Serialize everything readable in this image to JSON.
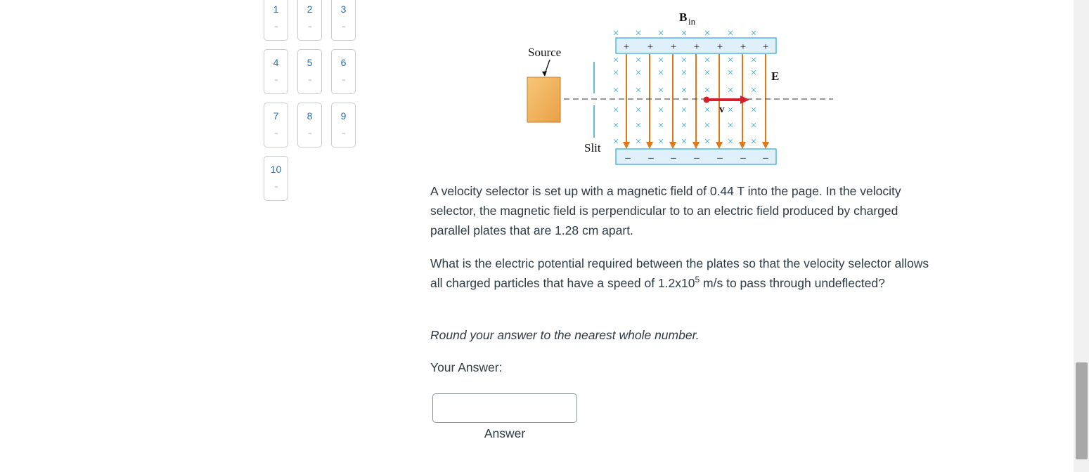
{
  "nav": {
    "items": [
      {
        "num": "1",
        "status": "--"
      },
      {
        "num": "2",
        "status": "--"
      },
      {
        "num": "3",
        "status": "--"
      },
      {
        "num": "4",
        "status": "--"
      },
      {
        "num": "5",
        "status": "--"
      },
      {
        "num": "6",
        "status": "--"
      },
      {
        "num": "7",
        "status": "--"
      },
      {
        "num": "8",
        "status": "--"
      },
      {
        "num": "9",
        "status": "--"
      },
      {
        "num": "10",
        "status": "--"
      }
    ]
  },
  "figure": {
    "b_label": "B",
    "b_sub": "in",
    "source_label": "Source",
    "slit_label": "Slit",
    "e_label": "E",
    "v_label": "v",
    "plus": "+",
    "minus": "–",
    "cross": "×"
  },
  "question": {
    "para1": "A velocity selector is set up with a magnetic field of 0.44 T into the page. In the velocity selector, the magnetic field is perpendicular to to an electric field produced by charged parallel plates that are 1.28 cm apart.",
    "para2_a": "What is the electric potential required between the plates so that the velocity selector allows all charged particles that have a speed of 1.2x10",
    "para2_sup": "5",
    "para2_b": " m/s to pass through undeflected?",
    "hint": "Round your answer to the nearest whole number.",
    "your_answer_label": "Your Answer:",
    "answer_value": "",
    "answer_caption": "Answer"
  },
  "colors": {
    "nav_num": "#2b6da8",
    "cross": "#2aa7d8",
    "field_line": "#e0781a",
    "velocity": "#d81e2a",
    "plate_fill": "#dff0fb",
    "source_fill": "#f4b65f"
  }
}
